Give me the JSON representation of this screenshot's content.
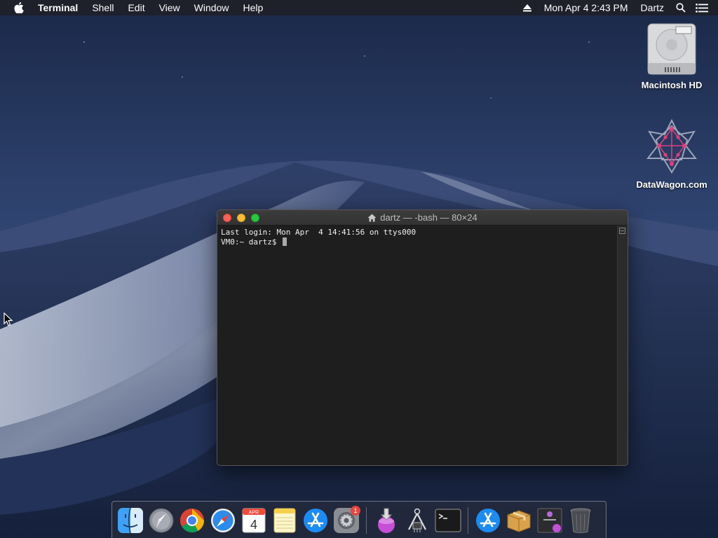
{
  "menubar": {
    "apple_icon": "apple-logo-icon",
    "app_name": "Terminal",
    "menus": [
      "Shell",
      "Edit",
      "View",
      "Window",
      "Help"
    ],
    "clock": "Mon Apr 4  2:43 PM",
    "user": "Dartz",
    "status_icons": [
      "eject-icon",
      "spotlight-search-icon",
      "notification-center-icon"
    ]
  },
  "desktop_icons": [
    {
      "label": "Macintosh HD",
      "icon": "hard-drive-icon"
    },
    {
      "label": "DataWagon.com",
      "icon": "datawagon-logo-icon"
    }
  ],
  "terminal": {
    "title": "dartz — -bash — 80×24",
    "title_icon": "home-folder-icon",
    "lines": [
      "Last login: Mon Apr  4 14:41:56 on ttys000",
      "VM0:~ dartz$ "
    ]
  },
  "dock": {
    "items": [
      {
        "name": "finder-icon",
        "running": true
      },
      {
        "name": "launchpad-icon",
        "running": false
      },
      {
        "name": "chrome-icon",
        "running": false
      },
      {
        "name": "safari-icon",
        "running": false
      },
      {
        "name": "calendar-icon",
        "month": "APR",
        "day": "4",
        "running": false
      },
      {
        "name": "notes-icon",
        "running": false
      },
      {
        "name": "app-store-icon",
        "running": false
      },
      {
        "name": "system-preferences-icon",
        "badge": "1",
        "running": false
      },
      {
        "name": "installer-icon",
        "running": true
      },
      {
        "name": "utility-tool-icon",
        "running": false
      },
      {
        "name": "terminal-icon",
        "running": true
      },
      {
        "name": "app-store-icon-2",
        "running": false
      },
      {
        "name": "package-icon",
        "running": false
      },
      {
        "name": "app-installer-icon",
        "running": false
      },
      {
        "name": "trash-icon",
        "running": false
      }
    ]
  },
  "colors": {
    "close": "#fe5f57",
    "minimize": "#febc2e",
    "maximize": "#28c840",
    "terminal_bg": "#1e1e1e",
    "badge": "#e8453c"
  }
}
